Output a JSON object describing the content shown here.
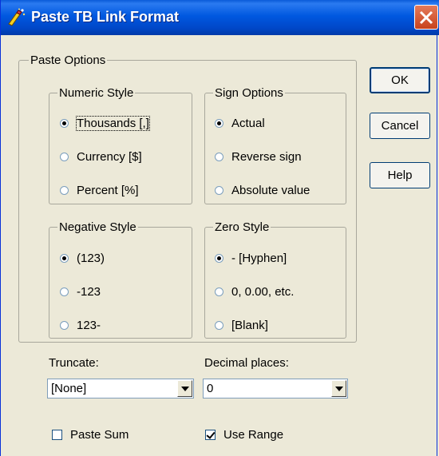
{
  "window": {
    "title": "Paste TB Link Format",
    "icon": "magic-wand-icon"
  },
  "paste_options": {
    "label": "Paste Options"
  },
  "numeric_style": {
    "label": "Numeric Style",
    "options": [
      "Thousands [,]",
      "Currency [$]",
      "Percent [%]"
    ],
    "selected": "Thousands [,]"
  },
  "sign_options": {
    "label": "Sign Options",
    "options": [
      "Actual",
      "Reverse sign",
      "Absolute value"
    ],
    "selected": "Actual"
  },
  "negative_style": {
    "label": "Negative Style",
    "options": [
      "(123)",
      "-123",
      "123-"
    ],
    "selected": "(123)"
  },
  "zero_style": {
    "label": "Zero Style",
    "options": [
      "- [Hyphen]",
      "0, 0.00, etc.",
      "[Blank]"
    ],
    "selected": "- [Hyphen]"
  },
  "truncate": {
    "label": "Truncate:",
    "value": "[None]"
  },
  "decimal_places": {
    "label": "Decimal places:",
    "value": "0"
  },
  "paste_sum": {
    "label": "Paste Sum",
    "checked": false
  },
  "use_range": {
    "label": "Use Range",
    "checked": true
  },
  "buttons": {
    "ok": "OK",
    "cancel": "Cancel",
    "help": "Help"
  }
}
